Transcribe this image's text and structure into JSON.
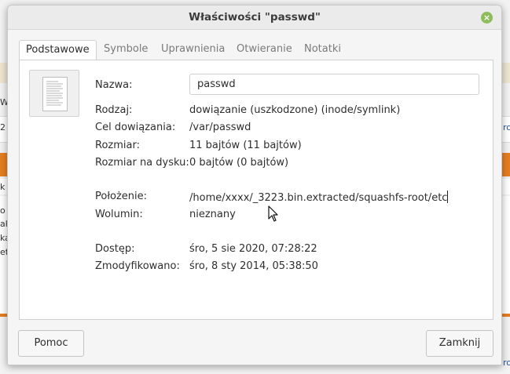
{
  "background": {
    "fragments_left": [
      "2",
      "k",
      "o",
      "ak",
      "ka",
      "zi",
      "et",
      "Wy"
    ],
    "fragments_right": [
      "ro",
      "ro"
    ]
  },
  "dialog": {
    "title": "Właściwości \"passwd\"",
    "close_label": "×",
    "tabs": [
      {
        "label": "Podstawowe",
        "active": true
      },
      {
        "label": "Symbole",
        "active": false
      },
      {
        "label": "Uprawnienia",
        "active": false
      },
      {
        "label": "Otwieranie",
        "active": false
      },
      {
        "label": "Notatki",
        "active": false
      }
    ],
    "file_icon": "text-document-icon",
    "fields": {
      "name_label": "Nazwa:",
      "name_value": "passwd",
      "type_label": "Rodzaj:",
      "type_value": "dowiązanie (uszkodzone) (inode/symlink)",
      "target_label": "Cel dowiązania:",
      "target_value": "/var/passwd",
      "size_label": "Rozmiar:",
      "size_value": "11 bajtów (11 bajtów)",
      "disk_size_label": "Rozmiar na dysku:",
      "disk_size_value": "0 bajtów (0 bajtów)",
      "location_label": "Położenie:",
      "location_value": "/home/xxxx/_3223.bin.extracted/squashfs-root/etc",
      "volume_label": "Wolumin:",
      "volume_value": "nieznany",
      "access_label": "Dostęp:",
      "access_value": "śro, 5 sie 2020, 07:28:22",
      "modified_label": "Zmodyfikowano:",
      "modified_value": "śro, 8 sty 2014, 05:38:50"
    },
    "buttons": {
      "help": "Pomoc",
      "close": "Zamknij"
    }
  },
  "colors": {
    "accent_green": "#8fbc5a",
    "background_orange": "#e67e22"
  }
}
